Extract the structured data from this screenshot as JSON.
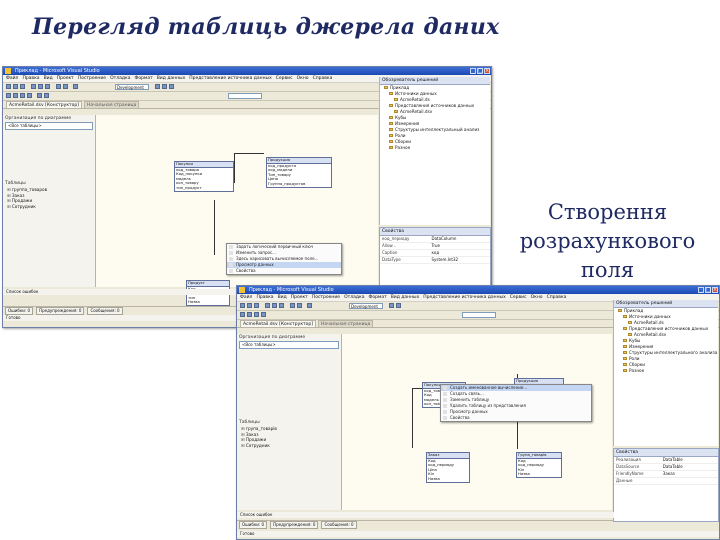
{
  "slide": {
    "title": "Перегляд таблиць джерела даних",
    "side_note": [
      "Створення",
      "розрахункового",
      "поля"
    ]
  },
  "window1": {
    "title": "Приклад - Microsoft Visual Studio",
    "menu": [
      "Файл",
      "Правка",
      "Вид",
      "Проект",
      "Построение",
      "Отладка",
      "Формат",
      "Вид данных",
      "Представление источника данных",
      "Сервис",
      "Окно",
      "Справка"
    ],
    "toolbar_combo": "Development",
    "tabs": [
      "AcmeRetail.dsv [Конструктор]",
      "Начальная страница"
    ],
    "left_pane": {
      "header": "Организация по диаграмме",
      "combo_value": "<Все таблицы>",
      "tables_header": "Таблицы",
      "tables": [
        "группа_товаров",
        "Заказ",
        "Продажи",
        "Сотрудник"
      ]
    },
    "diagram": {
      "tables": [
        {
          "name": "Покупки",
          "fields": [
            "код_товара",
            "Код_покупки",
            "модель",
            "кол_товару",
            "тип_продукт"
          ]
        },
        {
          "name": "Продукция",
          "fields": [
            "код_продукта",
            "код_модели",
            "Тип_товару",
            "Цена",
            "Группа_продуктов"
          ]
        },
        {
          "name": "Продукт",
          "fields": [
            "Код",
            "код_товару",
            "тип",
            "Назва"
          ]
        }
      ],
      "context_menu": [
        "Задать логический первичный ключ",
        "Изменить запрос...",
        "Здесь нарисовать вычисляемое поле...",
        "Просмотр данных",
        "Свойства"
      ],
      "context_highlight_index": 3
    },
    "right_pane": {
      "header": "Обозреватель решений",
      "tree": [
        "Приклад",
        "Источники данных",
        "AcmeRetail.ds",
        "Представления источников данных",
        "AcmeRetail.dsv",
        "Кубы",
        "Измерения",
        "Структуры интеллектуальный анализ",
        "Роли",
        "Сборки",
        "Разное"
      ]
    },
    "properties": {
      "header": "Свойства",
      "rows": [
        [
          "код_периоду",
          "DataColumn"
        ],
        [
          "Allow...",
          "True"
        ],
        [
          "Caption",
          "код"
        ],
        [
          "DataType",
          "System.Int32"
        ]
      ]
    },
    "sub_status": "Список ошибок",
    "status_items": [
      "Ошибки: 0",
      "Предупреждения: 0",
      "Сообщения: 0"
    ],
    "ready": "Готово"
  },
  "window2": {
    "title": "Приклад - Microsoft Visual Studio",
    "menu": [
      "Файл",
      "Правка",
      "Вид",
      "Проект",
      "Построение",
      "Отладка",
      "Формат",
      "Вид данных",
      "Представление источника данных",
      "Сервис",
      "Окно",
      "Справка"
    ],
    "toolbar_combo": "Development",
    "tabs": [
      "AcmeRetail.dsv [Конструктор]",
      "Начальная страница"
    ],
    "left_pane": {
      "header": "Организация по диаграмме",
      "combo_value": "<Все таблицы>",
      "tables_header": "Таблицы",
      "tables": [
        "група_товарів",
        "Заказ",
        "Продажи",
        "Сотрудник"
      ]
    },
    "diagram": {
      "tables": [
        {
          "name": "Покупки",
          "fields": [
            "код_товара",
            "Код",
            "модель",
            "кол_товару"
          ]
        },
        {
          "name": "Продукция",
          "fields": [
            "код_продукта",
            "код_модели",
            "Тип_товару",
            "Цена"
          ]
        },
        {
          "name": "Заказ",
          "fields": [
            "Код",
            "код_периоду",
            "Ціна",
            "Кіл",
            "Назва"
          ]
        },
        {
          "name": "Група_товарів",
          "fields": [
            "Код",
            "код_периоду",
            "Кіл",
            "Назва"
          ]
        }
      ],
      "context_menu": [
        "Создать именованное вычисление...",
        "Создать связь...",
        "Заменить таблицу",
        "Удалить таблицу из представления",
        "Просмотр данных",
        "Свойства"
      ],
      "context_highlight_index": 0
    },
    "right_pane": {
      "header": "Обозреватель решений",
      "tree": [
        "Приклад",
        "Источники данных",
        "AcmeRetail.ds",
        "Представления источников данных",
        "AcmeRetail.dsv",
        "Кубы",
        "Измерения",
        "Структуры интеллектуального анализа",
        "Роли",
        "Сборки",
        "Разное"
      ]
    },
    "properties": {
      "header": "Свойства",
      "rows": [
        [
          "Реализация",
          "DataTable"
        ],
        [
          "DataSource",
          "DataTable"
        ],
        [
          "FriendlyName",
          "Заказ"
        ],
        [
          "Данные",
          ""
        ]
      ]
    },
    "sub_status": "Список ошибок",
    "status_items": [
      "Ошибки: 0",
      "Предупреждения: 0",
      "Сообщения: 0"
    ],
    "ready": "Готово"
  }
}
